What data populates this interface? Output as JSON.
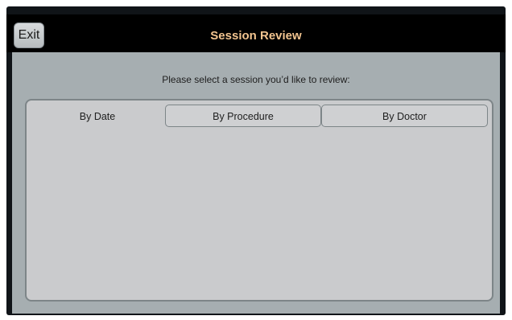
{
  "header": {
    "title": "Session Review",
    "exit_label": "Exit"
  },
  "main": {
    "prompt": "Please select a session you’d like to review:",
    "tabs": [
      {
        "label": "By Date",
        "active": true
      },
      {
        "label": "By Procedure",
        "active": false
      },
      {
        "label": "By Doctor",
        "active": false
      }
    ]
  },
  "colors": {
    "title_text": "#f2c48f",
    "titlebar_bg": "#000000",
    "content_bg": "#a6aeb1",
    "panel_bg": "#cacbcd"
  }
}
